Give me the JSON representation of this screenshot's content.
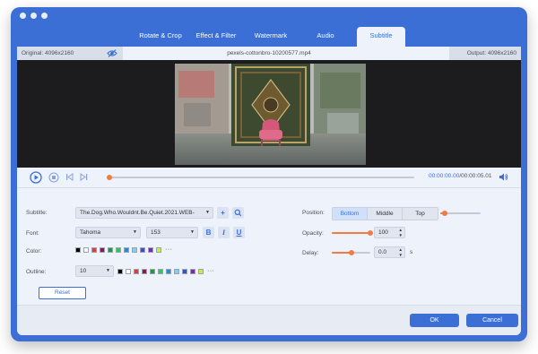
{
  "tabs": [
    {
      "label": "Rotate & Crop"
    },
    {
      "label": "Effect & Filter"
    },
    {
      "label": "Watermark"
    },
    {
      "label": "Audio"
    },
    {
      "label": "Subtitle",
      "active": true
    }
  ],
  "info": {
    "original": "Original: 4096x2160",
    "filename": "pexels-cottonbro-10200577.mp4",
    "output": "Output: 4096x2160"
  },
  "player": {
    "current_time": "00:00:00.00",
    "total_time": "/00:00:05.01",
    "progress": 0.0
  },
  "subtitle": {
    "label": "Subtitle:",
    "value": "The.Dog.Who.Wouldnt.Be.Quiet.2021.WEB-"
  },
  "font": {
    "label": "Font:",
    "family": "Tahoma",
    "size": "153",
    "bold": "B",
    "italic": "I",
    "underline": "U"
  },
  "color": {
    "label": "Color:",
    "swatches": [
      "#000000",
      "#ffffff",
      "#e03a3a",
      "#8b1a4a",
      "#1f9a3a",
      "#2ec95a",
      "#2a8ad8",
      "#7fd0f0",
      "#3a50c8",
      "#7a2ab0",
      "#d3e838"
    ],
    "more": "···"
  },
  "outline": {
    "label": "Outline:",
    "value": "10",
    "swatches": [
      "#000000",
      "#ffffff",
      "#e03a3a",
      "#8b1a4a",
      "#1f9a3a",
      "#2ec95a",
      "#2a8ad8",
      "#7fd0f0",
      "#3a50c8",
      "#7a2ab0",
      "#d3e838"
    ],
    "more": "···"
  },
  "reset_label": "Reset",
  "position": {
    "label": "Position:",
    "options": [
      "Bottom",
      "Middle",
      "Top"
    ],
    "selected": "Bottom",
    "slider_value": 0.1
  },
  "opacity": {
    "label": "Opacity:",
    "value": "100",
    "level": 1.0
  },
  "delay": {
    "label": "Delay:",
    "value": "0.0",
    "unit": "s",
    "level": 0.5
  },
  "footer": {
    "ok": "OK",
    "cancel": "Cancel"
  },
  "colors": {
    "accent": "#3b6fd6",
    "slider": "#f07b45"
  }
}
